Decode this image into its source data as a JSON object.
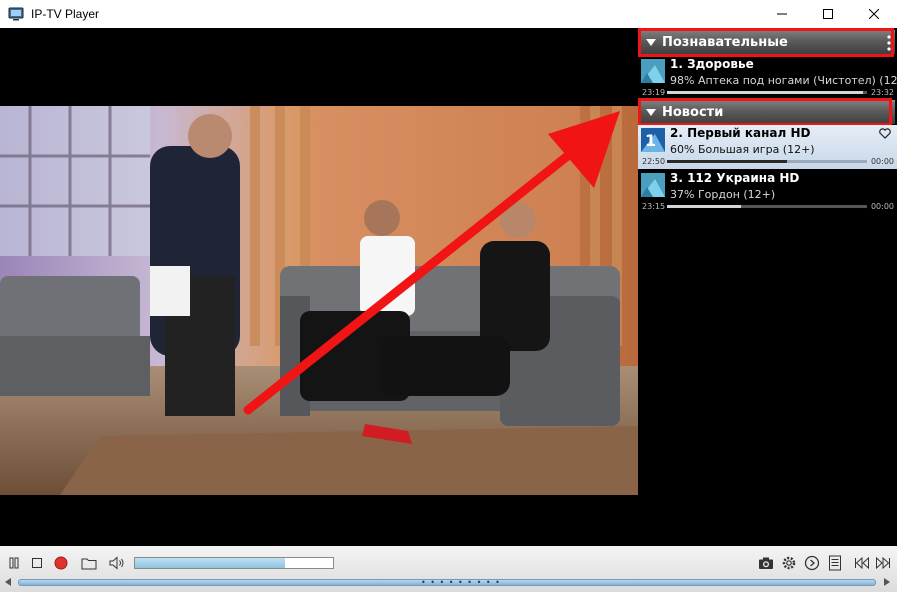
{
  "window": {
    "title": "IP-TV Player"
  },
  "playlist": {
    "groups": [
      {
        "title": "Познавательные",
        "channels": [
          {
            "name": "1. Здоровье",
            "program": "98% Аптека под ногами (Чистотел) (12+)",
            "start": "23:19",
            "end": "23:32",
            "progress": 0.98,
            "selected": false
          }
        ]
      },
      {
        "title": "Новости",
        "channels": [
          {
            "name": "2. Первый канал HD",
            "program": "60% Большая игра (12+)",
            "start": "22:50",
            "end": "00:00",
            "progress": 0.6,
            "selected": true
          },
          {
            "name": "3. 112 Украина HD",
            "program": "37% Гордон (12+)",
            "start": "23:15",
            "end": "00:00",
            "progress": 0.37,
            "selected": false
          }
        ]
      }
    ]
  },
  "controls": {
    "progress": 0.76
  },
  "colors": {
    "highlight": "#f01414",
    "accent": "#8ec4e0"
  },
  "icons": [
    "pause-icon",
    "stop-icon",
    "record-icon",
    "folder-icon",
    "volume-icon",
    "camera-icon",
    "gear-icon",
    "clock-icon",
    "playlist-icon",
    "previous-icon",
    "next-icon"
  ]
}
